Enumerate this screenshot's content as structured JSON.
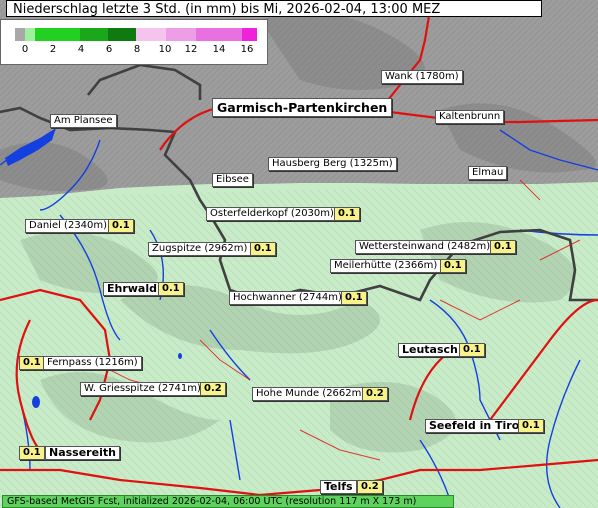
{
  "title": "Niederschlag letzte 3 Std. (in mm) bis Mi, 2026-02-04, 13:00 MEZ",
  "legend": {
    "ticks": [
      "0",
      "2",
      "4",
      "6",
      "8",
      "10",
      "12",
      "14",
      "16"
    ],
    "colors": [
      "#a8a8a8",
      "#9ef09e",
      "#22d022",
      "#1aa81a",
      "#0f7a0f",
      "#f4c4ee",
      "#ee9ee6",
      "#e870e0",
      "#ee22d8"
    ]
  },
  "places": {
    "garmisch": "Garmisch-Partenkirchen",
    "wank": "Wank (1780m)",
    "kaltenbrunn": "Kaltenbrunn",
    "am_plansee": "Am Plansee",
    "hausberg": "Hausberg Berg (1325m)",
    "eibsee": "Eibsee",
    "elmau": "Elmau",
    "osterfelderkopf": "Osterfelderkopf (2030m)",
    "daniel": "Daniel (2340m)",
    "zugspitze": "Zugspitze (2962m)",
    "wettersteinwand": "Wettersteinwand (2482m)",
    "meilerhuette": "Meilerhütte (2366m)",
    "ehrwald": "Ehrwald",
    "hochwanner": "Hochwanner (2744m)",
    "leutasch": "Leutasch",
    "fernpass": "Fernpass (1216m)",
    "griesspitze": "W. Griesspitze (2741m)",
    "hohe_munde": "Hohe Munde (2662m)",
    "seefeld": "Seefeld in Tirol",
    "nassereith": "Nassereith",
    "telfs": "Telfs"
  },
  "values": {
    "osterfelderkopf": "0.1",
    "daniel": "0.1",
    "zugspitze": "0.1",
    "wettersteinwand": "0.1",
    "meilerhuette": "0.1",
    "ehrwald": "0.1",
    "hochwanner": "0.1",
    "leutasch": "0.1",
    "fernpass": "0.1",
    "griesspitze": "0.2",
    "hohe_munde": "0.2",
    "seefeld": "0.1",
    "nassereith": "0.1",
    "telfs": "0.2"
  },
  "footer": "GFS-based MetGIS Fcst, initialized 2026-02-04, 06:00 UTC (resolution 117 m X 173 m)",
  "colors": {
    "dry_area": "#9a9a9a",
    "light_precip_area": "#c6ecc6",
    "road": "#e01010",
    "river": "#1040e0",
    "border": "#404040"
  }
}
